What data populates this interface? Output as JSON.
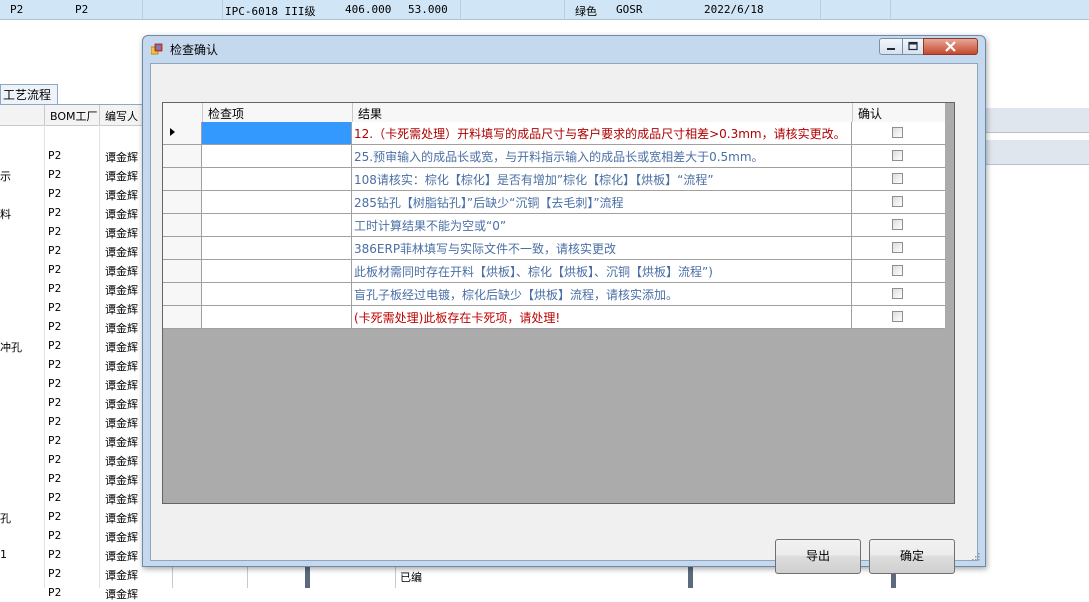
{
  "background": {
    "top_row": [
      "P2",
      "P2",
      "IPC-6018 III级",
      "406.000",
      "53.000",
      "绿色",
      "GOSR",
      "2022/6/18"
    ],
    "tab_label": "工艺流程",
    "columns": [
      "BOM工厂",
      "编写人"
    ],
    "rows": [
      {
        "prefix": "",
        "factory": "P2",
        "author": "谭金辉"
      },
      {
        "prefix": "示",
        "factory": "P2",
        "author": "谭金辉"
      },
      {
        "prefix": "",
        "factory": "P2",
        "author": "谭金辉"
      },
      {
        "prefix": "料",
        "factory": "P2",
        "author": "谭金辉"
      },
      {
        "prefix": "",
        "factory": "P2",
        "author": "谭金辉"
      },
      {
        "prefix": "",
        "factory": "P2",
        "author": "谭金辉"
      },
      {
        "prefix": "",
        "factory": "P2",
        "author": "谭金辉"
      },
      {
        "prefix": "",
        "factory": "P2",
        "author": "谭金辉"
      },
      {
        "prefix": "",
        "factory": "P2",
        "author": "谭金辉"
      },
      {
        "prefix": "",
        "factory": "P2",
        "author": "谭金辉"
      },
      {
        "prefix": "冲孔",
        "factory": "P2",
        "author": "谭金辉"
      },
      {
        "prefix": "",
        "factory": "P2",
        "author": "谭金辉"
      },
      {
        "prefix": "",
        "factory": "P2",
        "author": "谭金辉"
      },
      {
        "prefix": "",
        "factory": "P2",
        "author": "谭金辉"
      },
      {
        "prefix": "",
        "factory": "P2",
        "author": "谭金辉"
      },
      {
        "prefix": "",
        "factory": "P2",
        "author": "谭金辉"
      },
      {
        "prefix": "",
        "factory": "P2",
        "author": "谭金辉"
      },
      {
        "prefix": "",
        "factory": "P2",
        "author": "谭金辉"
      },
      {
        "prefix": "",
        "factory": "P2",
        "author": "谭金辉"
      },
      {
        "prefix": "孔",
        "factory": "P2",
        "author": "谭金辉"
      },
      {
        "prefix": "",
        "factory": "P2",
        "author": "谭金辉"
      },
      {
        "prefix": "1",
        "factory": "P2",
        "author": "谭金辉"
      },
      {
        "prefix": "",
        "factory": "P2",
        "author": "谭金辉"
      },
      {
        "prefix": "",
        "factory": "P2",
        "author": "谭金辉"
      }
    ],
    "bottom_text": "已编"
  },
  "dialog": {
    "title": "检查确认",
    "columns": {
      "item": "检查项",
      "result": "结果",
      "confirm": "确认"
    },
    "rows": [
      {
        "item": "",
        "result": "12.（卡死需处理）开料填写的成品尺寸与客户要求的成品尺寸相差>0.3mm，请核实更改。",
        "style": "red",
        "checked": false,
        "selected": true
      },
      {
        "item": "",
        "result": "25.预审输入的成品长或宽，与开料指示输入的成品长或宽相差大于0.5mm。",
        "style": "blue",
        "checked": false,
        "selected": false
      },
      {
        "item": "",
        "result": "108请核实：棕化【棕化】是否有增加”棕化【棕化】【烘板】“流程”",
        "style": "blue",
        "checked": false,
        "selected": false
      },
      {
        "item": "",
        "result": "285钻孔【树脂钻孔】”后缺少“沉铜【去毛刺】”流程",
        "style": "blue",
        "checked": false,
        "selected": false
      },
      {
        "item": "",
        "result": "工时计算结果不能为空或“0”",
        "style": "blue",
        "checked": false,
        "selected": false
      },
      {
        "item": "",
        "result": "386ERP菲林填写与实际文件不一致，请核实更改",
        "style": "blue",
        "checked": false,
        "selected": false
      },
      {
        "item": "",
        "result": "此板材需同时存在开料【烘板】、棕化【烘板】、沉铜【烘板】流程”)",
        "style": "blue",
        "checked": false,
        "selected": false
      },
      {
        "item": "",
        "result": "盲孔子板经过电镀，棕化后缺少【烘板】流程，请核实添加。",
        "style": "blue",
        "checked": false,
        "selected": false
      },
      {
        "item": "",
        "result": "(卡死需处理)此板存在卡死项，请处理!",
        "style": "redbold",
        "checked": false,
        "selected": false
      }
    ],
    "buttons": {
      "export": "导出",
      "ok": "确定"
    }
  },
  "colors": {
    "title_bar": "#c5d9ee",
    "selection": "#3399ff",
    "red_text": "#b00000",
    "blue_text": "#4a6fa5",
    "grid_bg": "#ababab"
  }
}
